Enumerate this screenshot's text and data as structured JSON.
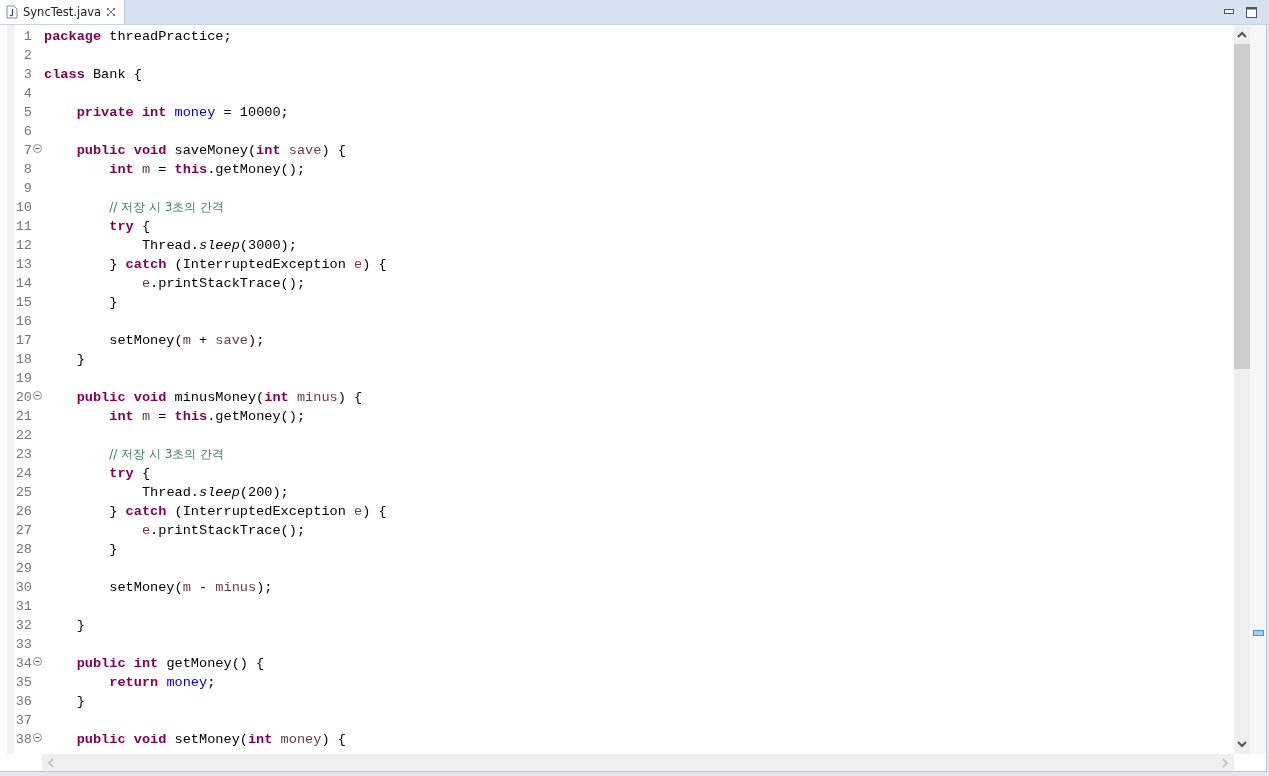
{
  "tabs": [
    {
      "title": "SyncTest.java",
      "selected": true
    }
  ],
  "lines": [
    {
      "number": "1",
      "foldable": false,
      "tokens": [
        {
          "kind": "keyword",
          "text": "package"
        },
        {
          "kind": "plain",
          "text": " threadPractice;"
        }
      ]
    },
    {
      "number": "2",
      "foldable": false
    },
    {
      "number": "3",
      "foldable": false,
      "tokens": [
        {
          "kind": "keyword",
          "text": "class"
        },
        {
          "kind": "plain",
          "text": " Bank {"
        }
      ]
    },
    {
      "number": "4",
      "foldable": false
    },
    {
      "number": "5",
      "foldable": false,
      "tokens": [
        {
          "kind": "keyword",
          "text": "\tprivate int "
        },
        {
          "kind": "field",
          "text": "money"
        },
        {
          "kind": "plain",
          "text": " = 10000;"
        }
      ]
    },
    {
      "number": "6",
      "foldable": false
    },
    {
      "number": "7",
      "foldable": true,
      "tokens": [
        {
          "kind": "keyword",
          "text": "\tpublic void"
        },
        {
          "kind": "plain",
          "text": " saveMoney("
        },
        {
          "kind": "keyword",
          "text": "int "
        },
        {
          "kind": "variable",
          "text": "save"
        },
        {
          "kind": "plain",
          "text": ") {"
        }
      ]
    },
    {
      "number": "8",
      "foldable": false,
      "tokens": [
        {
          "kind": "keyword",
          "text": "\t\tint "
        },
        {
          "kind": "variable",
          "text": "m"
        },
        {
          "kind": "plain",
          "text": " = "
        },
        {
          "kind": "keyword",
          "text": "this"
        },
        {
          "kind": "plain",
          "text": ".getMoney();"
        }
      ]
    },
    {
      "number": "9",
      "foldable": false
    },
    {
      "number": "10",
      "foldable": false,
      "tokens": [
        {
          "kind": "comment",
          "text": "\t\t// 저장 시 3초의 간격"
        }
      ]
    },
    {
      "number": "11",
      "foldable": false,
      "tokens": [
        {
          "kind": "keyword",
          "text": "\t\ttry"
        },
        {
          "kind": "plain",
          "text": " {"
        }
      ]
    },
    {
      "number": "12",
      "foldable": false,
      "tokens": [
        {
          "kind": "plain",
          "text": "\t\t\tThread."
        },
        {
          "kind": "static",
          "text": "sleep"
        },
        {
          "kind": "plain",
          "text": "(3000);"
        }
      ]
    },
    {
      "number": "13",
      "foldable": false,
      "tokens": [
        {
          "kind": "plain",
          "text": "\t\t} "
        },
        {
          "kind": "keyword",
          "text": "catch"
        },
        {
          "kind": "plain",
          "text": " (InterruptedException "
        },
        {
          "kind": "variable",
          "text": "e"
        },
        {
          "kind": "plain",
          "text": ") {"
        }
      ]
    },
    {
      "number": "14",
      "foldable": false,
      "tokens": [
        {
          "kind": "variable",
          "text": "\t\t\te"
        },
        {
          "kind": "plain",
          "text": ".printStackTrace();"
        }
      ]
    },
    {
      "number": "15",
      "foldable": false,
      "tokens": [
        {
          "kind": "plain",
          "text": "\t\t}"
        }
      ]
    },
    {
      "number": "16",
      "foldable": false
    },
    {
      "number": "17",
      "foldable": false,
      "tokens": [
        {
          "kind": "plain",
          "text": "\t\tsetMoney("
        },
        {
          "kind": "variable",
          "text": "m"
        },
        {
          "kind": "plain",
          "text": " + "
        },
        {
          "kind": "variable",
          "text": "save"
        },
        {
          "kind": "plain",
          "text": ");"
        }
      ]
    },
    {
      "number": "18",
      "foldable": false,
      "tokens": [
        {
          "kind": "plain",
          "text": "\t}"
        }
      ]
    },
    {
      "number": "19",
      "foldable": false
    },
    {
      "number": "20",
      "foldable": true,
      "tokens": [
        {
          "kind": "keyword",
          "text": "\tpublic void"
        },
        {
          "kind": "plain",
          "text": " minusMoney("
        },
        {
          "kind": "keyword",
          "text": "int "
        },
        {
          "kind": "variable",
          "text": "minus"
        },
        {
          "kind": "plain",
          "text": ") {"
        }
      ]
    },
    {
      "number": "21",
      "foldable": false,
      "tokens": [
        {
          "kind": "keyword",
          "text": "\t\tint "
        },
        {
          "kind": "variable",
          "text": "m"
        },
        {
          "kind": "plain",
          "text": " = "
        },
        {
          "kind": "keyword",
          "text": "this"
        },
        {
          "kind": "plain",
          "text": ".getMoney();"
        }
      ]
    },
    {
      "number": "22",
      "foldable": false
    },
    {
      "number": "23",
      "foldable": false,
      "tokens": [
        {
          "kind": "comment",
          "text": "\t\t// 저장 시 3초의 간격"
        }
      ]
    },
    {
      "number": "24",
      "foldable": false,
      "tokens": [
        {
          "kind": "keyword",
          "text": "\t\ttry"
        },
        {
          "kind": "plain",
          "text": " {"
        }
      ]
    },
    {
      "number": "25",
      "foldable": false,
      "tokens": [
        {
          "kind": "plain",
          "text": "\t\t\tThread."
        },
        {
          "kind": "static",
          "text": "sleep"
        },
        {
          "kind": "plain",
          "text": "(200);"
        }
      ]
    },
    {
      "number": "26",
      "foldable": false,
      "tokens": [
        {
          "kind": "plain",
          "text": "\t\t} "
        },
        {
          "kind": "keyword",
          "text": "catch"
        },
        {
          "kind": "plain",
          "text": " (InterruptedException "
        },
        {
          "kind": "variable",
          "text": "e"
        },
        {
          "kind": "plain",
          "text": ") {"
        }
      ]
    },
    {
      "number": "27",
      "foldable": false,
      "tokens": [
        {
          "kind": "variable",
          "text": "\t\t\te"
        },
        {
          "kind": "plain",
          "text": ".printStackTrace();"
        }
      ]
    },
    {
      "number": "28",
      "foldable": false,
      "tokens": [
        {
          "kind": "plain",
          "text": "\t\t}"
        }
      ]
    },
    {
      "number": "29",
      "foldable": false
    },
    {
      "number": "30",
      "foldable": false,
      "tokens": [
        {
          "kind": "plain",
          "text": "\t\tsetMoney("
        },
        {
          "kind": "variable",
          "text": "m"
        },
        {
          "kind": "plain",
          "text": " - "
        },
        {
          "kind": "variable",
          "text": "minus"
        },
        {
          "kind": "plain",
          "text": ");"
        }
      ]
    },
    {
      "number": "31",
      "foldable": false
    },
    {
      "number": "32",
      "foldable": false,
      "tokens": [
        {
          "kind": "plain",
          "text": "\t}"
        }
      ]
    },
    {
      "number": "33",
      "foldable": false
    },
    {
      "number": "34",
      "foldable": true,
      "tokens": [
        {
          "kind": "keyword",
          "text": "\tpublic int"
        },
        {
          "kind": "plain",
          "text": " getMoney() {"
        }
      ]
    },
    {
      "number": "35",
      "foldable": false,
      "tokens": [
        {
          "kind": "keyword",
          "text": "\t\treturn "
        },
        {
          "kind": "field",
          "text": "money"
        },
        {
          "kind": "plain",
          "text": ";"
        }
      ]
    },
    {
      "number": "36",
      "foldable": false,
      "tokens": [
        {
          "kind": "plain",
          "text": "\t}"
        }
      ]
    },
    {
      "number": "37",
      "foldable": false
    },
    {
      "number": "38",
      "foldable": true,
      "tokens": [
        {
          "kind": "keyword",
          "text": "\tpublic void"
        },
        {
          "kind": "plain",
          "text": " setMoney("
        },
        {
          "kind": "keyword",
          "text": "int "
        },
        {
          "kind": "variable",
          "text": "money"
        },
        {
          "kind": "plain",
          "text": ") {"
        }
      ]
    }
  ]
}
